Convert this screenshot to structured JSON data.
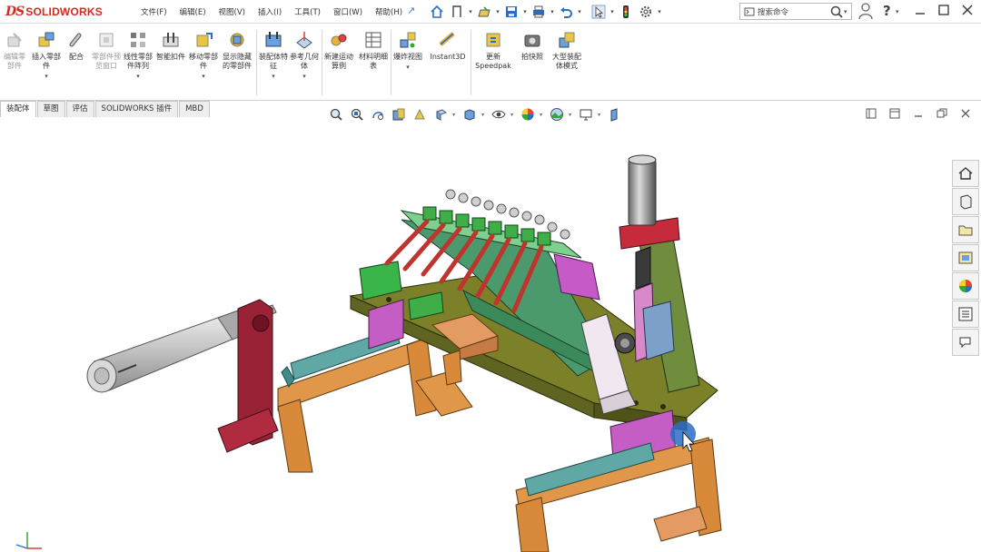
{
  "app": {
    "brand_ds": "DS",
    "brand_name": "SOLIDWORKS"
  },
  "menu": [
    "文件(F)",
    "编辑(E)",
    "视图(V)",
    "插入(I)",
    "工具(T)",
    "窗口(W)",
    "帮助(H)"
  ],
  "search": {
    "placeholder": "搜索命令"
  },
  "ribbon": [
    {
      "label": "编辑零部件",
      "disabled": true,
      "icon": "edit-component-icon"
    },
    {
      "label": "插入零部件",
      "disabled": false,
      "icon": "insert-components-icon",
      "dropdown": true
    },
    {
      "label": "配合",
      "disabled": false,
      "icon": "mate-icon"
    },
    {
      "label": "零部件预览窗口",
      "disabled": true,
      "icon": "component-preview-icon"
    },
    {
      "label": "线性零部件阵列",
      "disabled": false,
      "icon": "linear-pattern-icon",
      "dropdown": true
    },
    {
      "label": "智能扣件",
      "disabled": false,
      "icon": "smart-fasteners-icon"
    },
    {
      "label": "移动零部件",
      "disabled": false,
      "icon": "move-component-icon",
      "dropdown": true
    },
    {
      "label": "显示隐藏的零部件",
      "disabled": false,
      "icon": "show-hidden-icon"
    },
    {
      "label": "装配体特征",
      "disabled": false,
      "icon": "assembly-features-icon",
      "dropdown": true
    },
    {
      "label": "参考几何体",
      "disabled": false,
      "icon": "reference-geometry-icon",
      "dropdown": true
    },
    {
      "label": "新建运动算例",
      "disabled": false,
      "icon": "motion-study-icon"
    },
    {
      "label": "材料明细表",
      "disabled": false,
      "icon": "bom-icon"
    },
    {
      "label": "爆炸视图",
      "disabled": false,
      "icon": "exploded-view-icon",
      "dropdown": true
    },
    {
      "label": "Instant3D",
      "disabled": false,
      "icon": "instant3d-icon"
    },
    {
      "label": "更新 Speedpak",
      "disabled": false,
      "icon": "speedpak-icon"
    },
    {
      "label": "拍快照",
      "disabled": false,
      "icon": "snapshot-icon"
    },
    {
      "label": "大型装配体模式",
      "disabled": false,
      "icon": "large-assembly-icon"
    }
  ],
  "tabs": [
    {
      "label": "装配体",
      "active": true
    },
    {
      "label": "草图",
      "active": false
    },
    {
      "label": "评估",
      "active": false
    },
    {
      "label": "SOLIDWORKS 插件",
      "active": false
    },
    {
      "label": "MBD",
      "active": false
    }
  ],
  "colors": {
    "brand_red": "#d52b1e",
    "teal_rail": "#5aa5a3",
    "orange_stand": "#d98d3a",
    "olive_plate": "#7b7f27",
    "green_part": "#3fae49",
    "magenta_part": "#c65ac6",
    "red_bracket": "#a8263b"
  }
}
